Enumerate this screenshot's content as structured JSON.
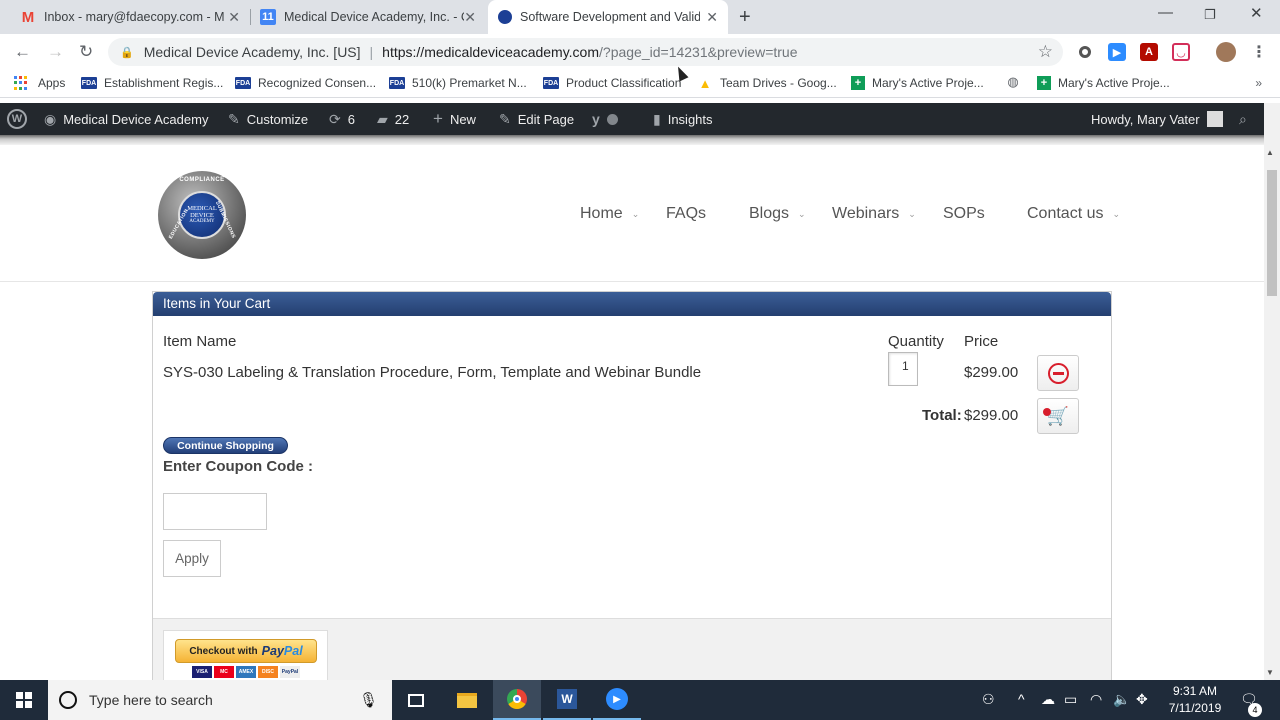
{
  "browser": {
    "tabs": [
      {
        "title": "Inbox - mary@fdaecopy.com - M",
        "icon": "gmail-icon",
        "color": "#ea4335",
        "active": false
      },
      {
        "title": "Medical Device Academy, Inc. - C",
        "icon": "calendar-icon",
        "color": "#4285f4",
        "active": false
      },
      {
        "title": "Software Development and Valid",
        "icon": "site-icon",
        "color": "#1c3f95",
        "active": true
      }
    ],
    "site_label": "Medical Device Academy, Inc. [US]",
    "url_host": "https://medicaldeviceacademy.com",
    "url_path": "/?page_id=14231&preview=true"
  },
  "bookmarks": [
    {
      "label": "Apps",
      "icon": "apps-grid-icon"
    },
    {
      "label": "Establishment Regis...",
      "icon": "fda-icon"
    },
    {
      "label": "Recognized Consen...",
      "icon": "fda-icon"
    },
    {
      "label": "510(k) Premarket N...",
      "icon": "fda-icon"
    },
    {
      "label": "Product Classification",
      "icon": "fda-icon"
    },
    {
      "label": "Team Drives - Goog...",
      "icon": "google-drive-icon"
    },
    {
      "label": "Mary's Active Proje...",
      "icon": "sheets-icon"
    },
    {
      "label": "Mary's Active Proje...",
      "icon": "sheets-icon"
    }
  ],
  "adminbar": {
    "site_name": "Medical Device Academy",
    "customize": "Customize",
    "updates_count": "6",
    "comments_count": "22",
    "new": "New",
    "edit_page": "Edit Page",
    "insights": "Insights",
    "howdy": "Howdy, Mary Vater"
  },
  "logo": {
    "top_text": "COMPLIANCE",
    "center_line1": "MEDICAL",
    "center_line2": "DEVICE",
    "center_line3": "ACADEMY",
    "left_text": "EDUCATION",
    "right_text": "SUBMISSIONS"
  },
  "menu": [
    {
      "label": "Home",
      "has_dropdown": true
    },
    {
      "label": "FAQs",
      "has_dropdown": false
    },
    {
      "label": "Blogs",
      "has_dropdown": true
    },
    {
      "label": "Webinars",
      "has_dropdown": true
    },
    {
      "label": "SOPs",
      "has_dropdown": false
    },
    {
      "label": "Contact us",
      "has_dropdown": true
    }
  ],
  "cart": {
    "header": "Items in Your Cart",
    "col_item": "Item Name",
    "col_qty": "Quantity",
    "col_price": "Price",
    "item_name": "SYS-030 Labeling & Translation Procedure, Form, Template and Webinar Bundle",
    "item_qty": "1",
    "item_price": "$299.00",
    "total_label": "Total:",
    "total_value": "$299.00",
    "continue_label": "Continue Shopping",
    "coupon_label": "Enter Coupon Code :",
    "apply_label": "Apply",
    "paypal_prefix": "Checkout with",
    "paypal_brand_a": "Pay",
    "paypal_brand_b": "Pal",
    "cards": [
      "VISA",
      "MC",
      "AMEX",
      "DISC",
      "PayPal"
    ]
  },
  "taskbar": {
    "search_placeholder": "Type here to search",
    "time": "9:31 AM",
    "date": "7/11/2019",
    "notifications": "4"
  },
  "colors": {
    "admin_bar": "#23282d",
    "cart_header": "#2f4f85",
    "remove_red": "#d81e2c",
    "taskbar": "#1f2b3a"
  }
}
